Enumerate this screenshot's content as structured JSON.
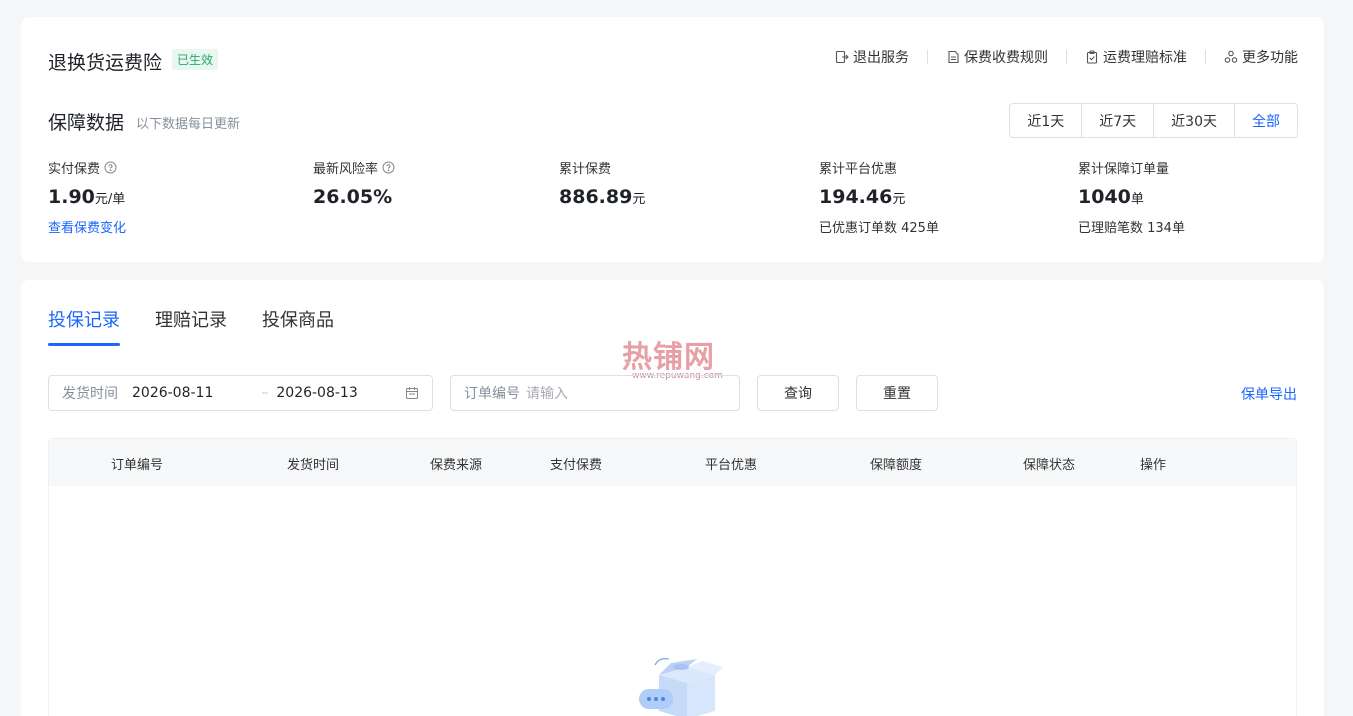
{
  "header": {
    "title": "退换货运费险",
    "status_badge": "已生效",
    "links": [
      {
        "label": "退出服务",
        "icon": "exit-icon"
      },
      {
        "label": "保费收费规则",
        "icon": "document-icon"
      },
      {
        "label": "运费理赔标准",
        "icon": "clipboard-icon"
      },
      {
        "label": "更多功能",
        "icon": "more-apps-icon"
      }
    ]
  },
  "overview": {
    "title": "保障数据",
    "note": "以下数据每日更新",
    "ranges": [
      "近1天",
      "近7天",
      "近30天",
      "全部"
    ],
    "active_range": "全部",
    "stats": {
      "paid_premium": {
        "label": "实付保费",
        "value": "1.90",
        "unit": "元/单",
        "link": "查看保费变化"
      },
      "risk_rate": {
        "label": "最新风险率",
        "value": "26.05%"
      },
      "total_premium": {
        "label": "累计保费",
        "value": "886.89",
        "unit": "元"
      },
      "platform_discount": {
        "label": "累计平台优惠",
        "value": "194.46",
        "unit": "元",
        "sub": "已优惠订单数 425单"
      },
      "protected_orders": {
        "label": "累计保障订单量",
        "value": "1040",
        "unit": "单",
        "sub": "已理赔笔数 134单"
      }
    }
  },
  "tabs": [
    "投保记录",
    "理赔记录",
    "投保商品"
  ],
  "watermark": {
    "text": "热铺网",
    "url": "www.repuwang.com"
  },
  "filters": {
    "date_label": "发货时间",
    "date_start": "2026-08-11",
    "date_sep": "–",
    "date_end": "2026-08-13",
    "order_label": "订单编号",
    "order_placeholder": "请输入",
    "query_label": "查询",
    "reset_label": "重置",
    "export_label": "保单导出"
  },
  "table": {
    "columns": [
      "订单编号",
      "发货时间",
      "保费来源",
      "支付保费",
      "平台优惠",
      "保障额度",
      "保障状态",
      "操作"
    ],
    "rows": []
  },
  "colors": {
    "accent": "#1a66ff",
    "success": "#2aa86b",
    "watermark": "#e8a0a8"
  }
}
